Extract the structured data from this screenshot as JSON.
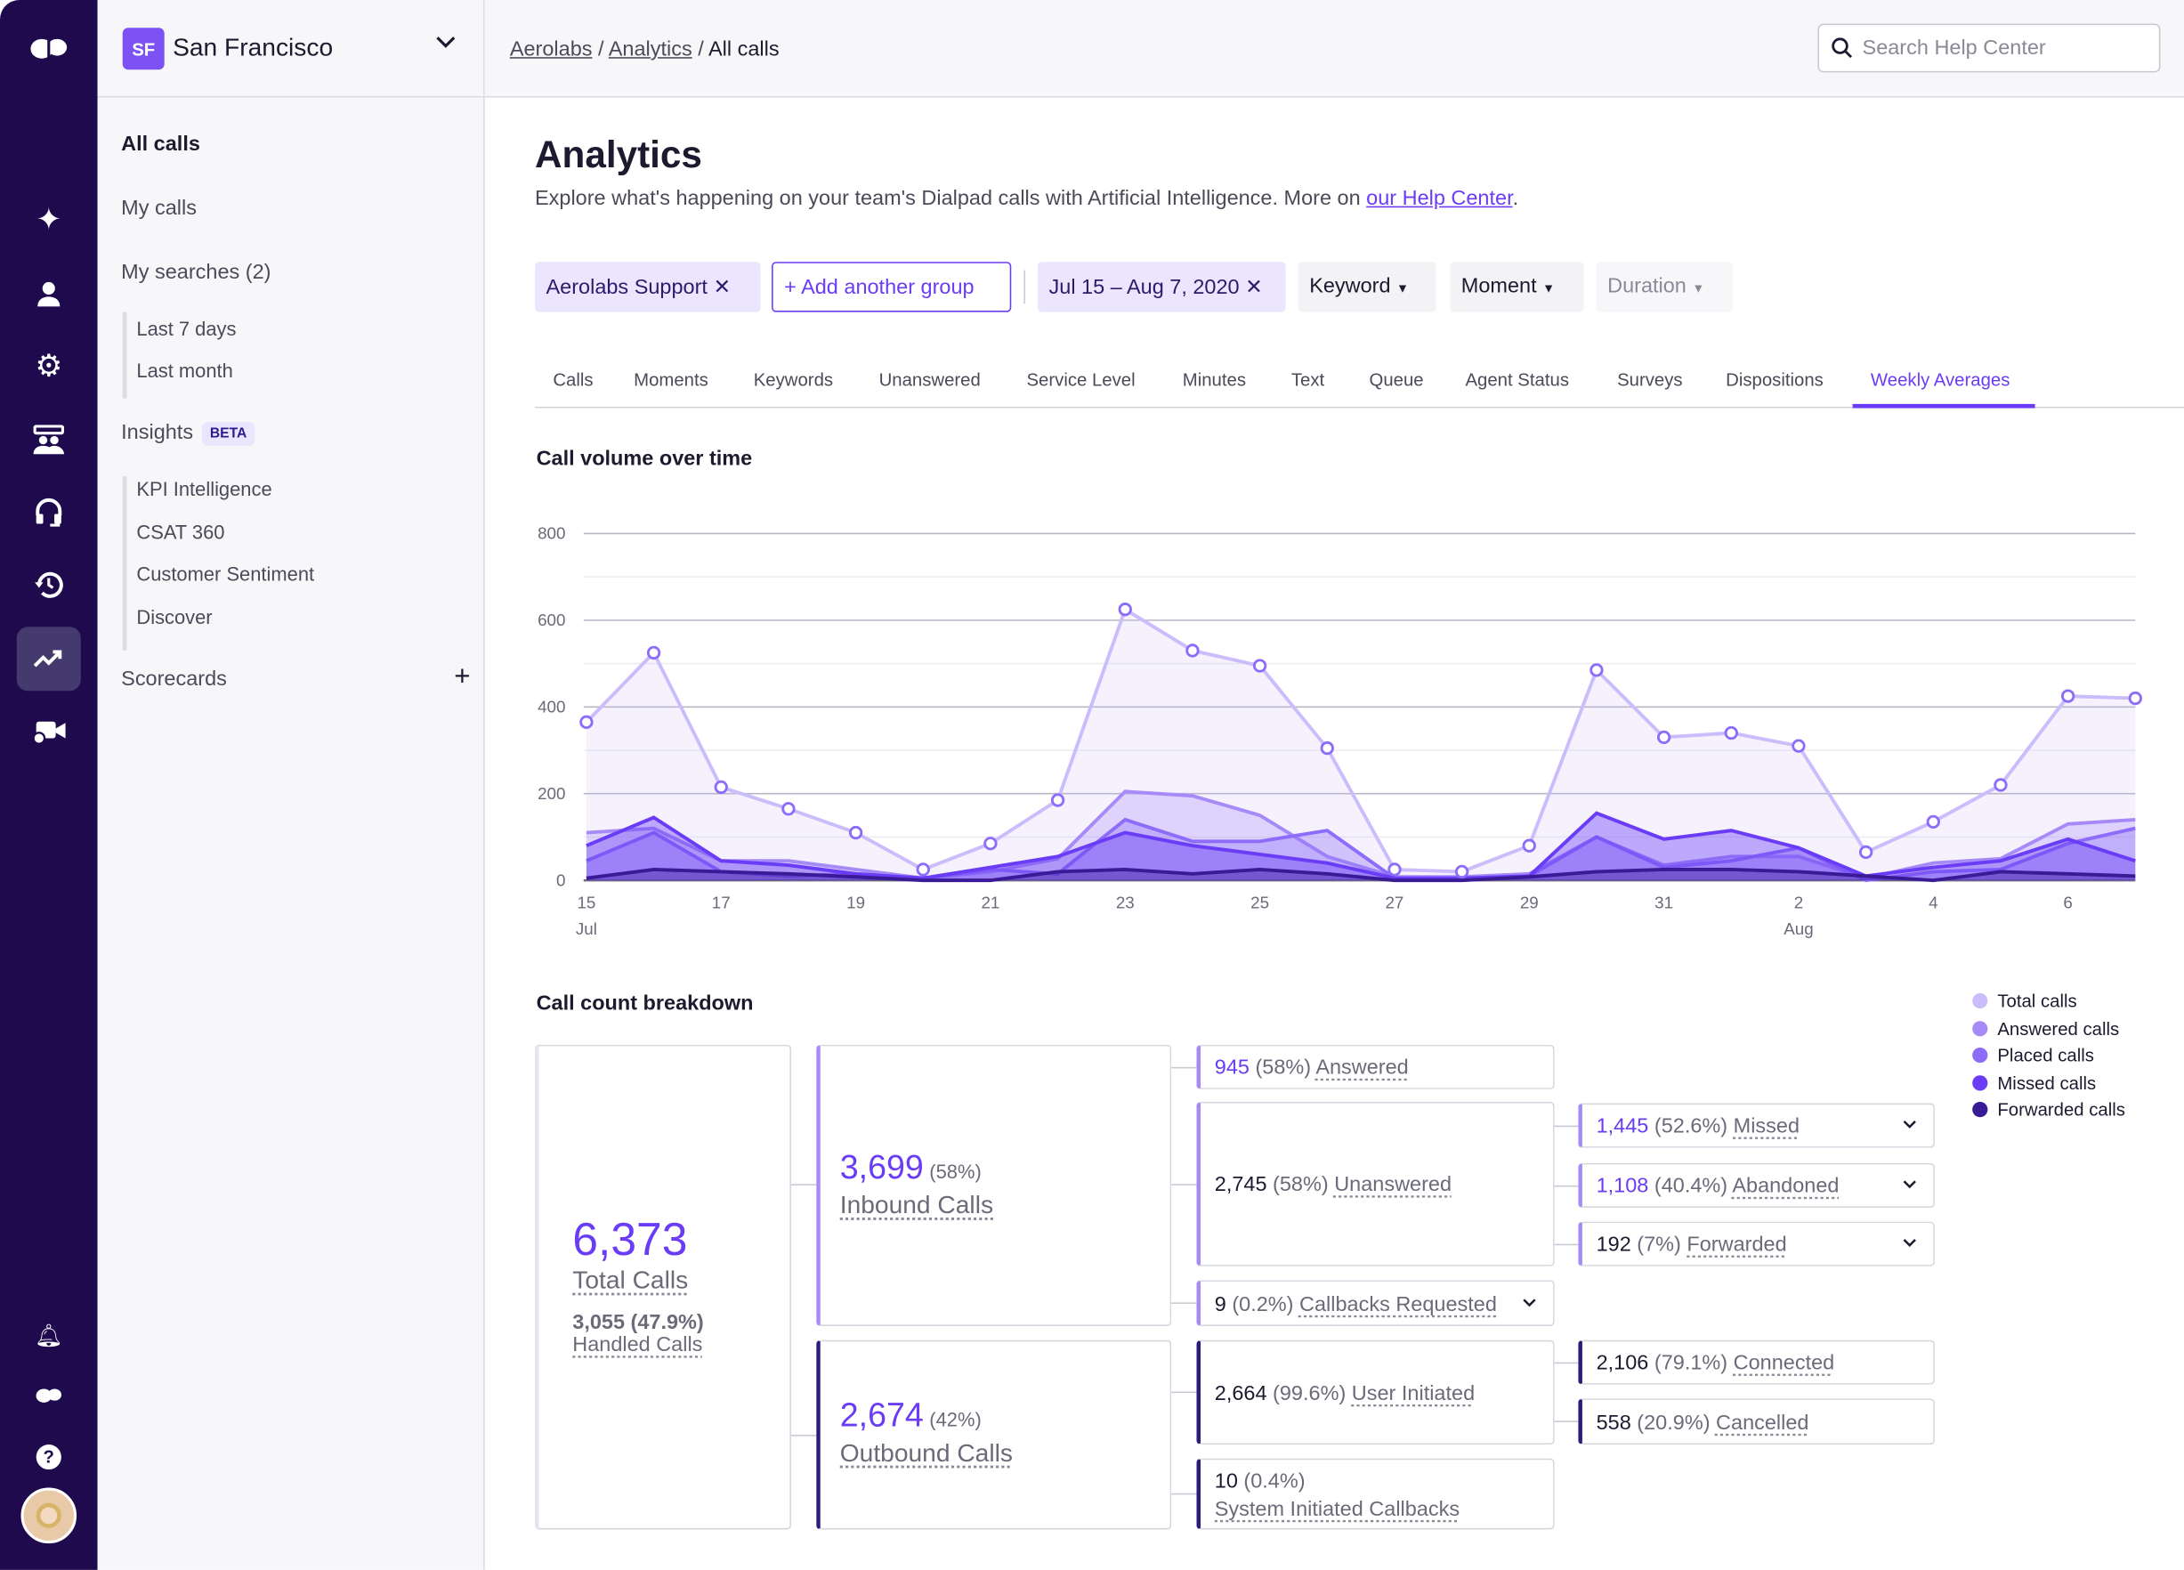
{
  "rail": {
    "icons": [
      "dialpad-logo-icon",
      "sparkles-icon",
      "person-icon",
      "gear-icon",
      "team-icon",
      "headset-icon",
      "history-icon",
      "analytics-trend-icon",
      "video-icon",
      "bell-icon",
      "dialpad-small-icon",
      "help-icon",
      "avatar"
    ]
  },
  "sidebar": {
    "workspace": "San Francisco",
    "workspace_initials": "SF",
    "all_calls": "All calls",
    "my_calls": "My calls",
    "my_searches": "My searches (2)",
    "searches": [
      "Last 7 days",
      "Last month"
    ],
    "insights": "Insights",
    "beta": "BETA",
    "insight_items": [
      "KPI Intelligence",
      "CSAT 360",
      "Customer Sentiment",
      "Discover"
    ],
    "scorecards": "Scorecards",
    "add": "+"
  },
  "topbar": {
    "breadcrumb": [
      "Aerolabs",
      "Analytics",
      "All calls"
    ],
    "separator": "/",
    "search_placeholder": "Search Help Center"
  },
  "page": {
    "title": "Analytics",
    "subtitle": "Explore what's happening on your team's Dialpad calls with Artificial Intelligence. More on ",
    "help_link": "our Help Center",
    "period": "."
  },
  "filters": {
    "group": "Aerolabs Support",
    "add_group": "+ Add another group",
    "date": "Jul 15 – Aug 7, 2020",
    "keyword": "Keyword",
    "moment": "Moment",
    "duration": "Duration"
  },
  "tabs": [
    "Calls",
    "Moments",
    "Keywords",
    "Unanswered",
    "Service Level",
    "Minutes",
    "Text",
    "Queue",
    "Agent Status",
    "Surveys",
    "Dispositions",
    "Weekly Averages"
  ],
  "active_tab": "Weekly Averages",
  "chart_title": "Call volume over time",
  "chart_data": {
    "type": "area",
    "ylim": [
      0,
      800
    ],
    "yticks": [
      0,
      200,
      400,
      600,
      800
    ],
    "grid": true,
    "x": [
      "Jul 15",
      "Jul 16",
      "Jul 17",
      "Jul 18",
      "Jul 19",
      "Jul 20",
      "Jul 21",
      "Jul 22",
      "Jul 23",
      "Jul 24",
      "Jul 25",
      "Jul 26",
      "Jul 27",
      "Jul 28",
      "Jul 29",
      "Jul 30",
      "Jul 31",
      "Aug 1",
      "Aug 2",
      "Aug 3",
      "Aug 4",
      "Aug 5",
      "Aug 6",
      "Aug 7"
    ],
    "xtick_labels": [
      {
        "i": 0,
        "d": "15",
        "m": "Jul"
      },
      {
        "i": 2,
        "d": "17"
      },
      {
        "i": 4,
        "d": "19"
      },
      {
        "i": 6,
        "d": "21"
      },
      {
        "i": 8,
        "d": "23"
      },
      {
        "i": 10,
        "d": "25"
      },
      {
        "i": 12,
        "d": "27"
      },
      {
        "i": 14,
        "d": "29"
      },
      {
        "i": 16,
        "d": "31"
      },
      {
        "i": 18,
        "d": "2",
        "m": "Aug"
      },
      {
        "i": 20,
        "d": "4"
      },
      {
        "i": 22,
        "d": "6"
      }
    ],
    "legend_position": "right",
    "series": [
      {
        "name": "Total calls",
        "color": "#cbbdfc",
        "values": [
          365,
          525,
          215,
          165,
          110,
          25,
          85,
          185,
          625,
          530,
          495,
          305,
          25,
          20,
          80,
          485,
          330,
          340,
          310,
          65,
          135,
          220,
          425,
          420
        ]
      },
      {
        "name": "Answered calls",
        "color": "#a68bf8",
        "values": [
          110,
          120,
          45,
          45,
          25,
          5,
          20,
          50,
          205,
          195,
          150,
          55,
          8,
          8,
          15,
          100,
          35,
          55,
          55,
          5,
          40,
          50,
          130,
          140
        ]
      },
      {
        "name": "Placed calls",
        "color": "#8c6cf9",
        "values": [
          45,
          110,
          20,
          10,
          15,
          5,
          25,
          15,
          140,
          90,
          90,
          115,
          5,
          5,
          10,
          100,
          30,
          45,
          75,
          0,
          20,
          25,
          85,
          120
        ]
      },
      {
        "name": "Missed calls",
        "color": "#6a3cf5",
        "values": [
          80,
          145,
          45,
          35,
          15,
          5,
          30,
          55,
          110,
          80,
          60,
          40,
          5,
          5,
          10,
          155,
          95,
          115,
          75,
          10,
          30,
          45,
          95,
          45
        ]
      },
      {
        "name": "Forwarded calls",
        "color": "#3a1a96",
        "values": [
          5,
          25,
          20,
          15,
          8,
          0,
          0,
          20,
          25,
          15,
          25,
          15,
          0,
          0,
          8,
          20,
          25,
          25,
          20,
          10,
          0,
          20,
          15,
          10
        ]
      }
    ]
  },
  "breakdown": {
    "title": "Call count breakdown",
    "total": {
      "value": "6,373",
      "label": "Total Calls",
      "handled": "3,055 (47.9%)",
      "handled_label": "Handled Calls"
    },
    "inbound": {
      "value": "3,699",
      "pct": "(58%)",
      "label": "Inbound Calls"
    },
    "outbound": {
      "value": "2,674",
      "pct": "(42%)",
      "label": "Outbound Calls"
    },
    "answered": {
      "value": "945",
      "pct": "(58%)",
      "label": "Answered"
    },
    "unanswered": {
      "value": "2,745",
      "pct": "(58%)",
      "label": "Unanswered"
    },
    "callbacks": {
      "value": "9",
      "pct": "(0.2%)",
      "label": "Callbacks Requested"
    },
    "user_initiated": {
      "value": "2,664",
      "pct": "(99.6%)",
      "label": "User Initiated"
    },
    "system_initiated": {
      "value": "10",
      "pct": "(0.4%)",
      "label": "System Initiated Callbacks"
    },
    "missed": {
      "value": "1,445",
      "pct": "(52.6%)",
      "label": "Missed"
    },
    "abandoned": {
      "value": "1,108",
      "pct": "(40.4%)",
      "label": "Abandoned"
    },
    "forwarded": {
      "value": "192",
      "pct": "(7%)",
      "label": "Forwarded"
    },
    "connected": {
      "value": "2,106",
      "pct": "(79.1%)",
      "label": "Connected"
    },
    "cancelled": {
      "value": "558",
      "pct": "(20.9%)",
      "label": "Cancelled"
    }
  }
}
